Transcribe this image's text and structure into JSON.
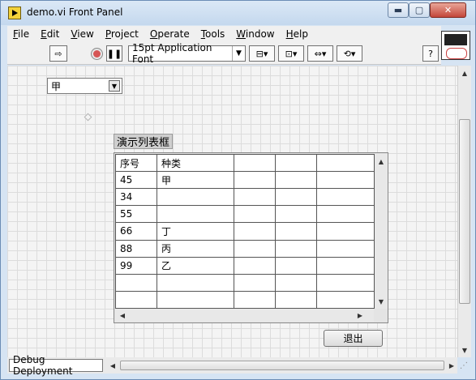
{
  "window": {
    "title": "demo.vi Front Panel",
    "controls": {
      "minimize": "▬",
      "maximize": "▢",
      "close": "✕"
    }
  },
  "menubar": {
    "items": [
      {
        "label": "File",
        "mnemonic": "F",
        "rest": "ile"
      },
      {
        "label": "Edit",
        "mnemonic": "E",
        "rest": "dit"
      },
      {
        "label": "View",
        "mnemonic": "V",
        "rest": "iew"
      },
      {
        "label": "Project",
        "mnemonic": "P",
        "rest": "roject"
      },
      {
        "label": "Operate",
        "mnemonic": "O",
        "rest": "perate"
      },
      {
        "label": "Tools",
        "mnemonic": "T",
        "rest": "ools"
      },
      {
        "label": "Window",
        "mnemonic": "W",
        "rest": "indow"
      },
      {
        "label": "Help",
        "mnemonic": "H",
        "rest": "elp"
      }
    ]
  },
  "toolbar": {
    "run_icon": "⇨",
    "pause_icon": "❚❚",
    "font_value": "15pt Application Font",
    "help_icon": "?"
  },
  "ring_control": {
    "value": "甲"
  },
  "listbox": {
    "label": "演示列表框",
    "headers": [
      "序号",
      "种类",
      "",
      "",
      ""
    ],
    "rows": [
      [
        "45",
        "甲",
        "",
        "",
        ""
      ],
      [
        "34",
        "",
        "",
        "",
        ""
      ],
      [
        "55",
        "",
        "",
        "",
        ""
      ],
      [
        "66",
        "丁",
        "",
        "",
        ""
      ],
      [
        "88",
        "丙",
        "",
        "",
        ""
      ],
      [
        "99",
        "乙",
        "",
        "",
        ""
      ],
      [
        "",
        "",
        "",
        "",
        ""
      ],
      [
        "",
        "",
        "",
        "",
        ""
      ]
    ]
  },
  "exit_button": {
    "label": "退出"
  },
  "bottombar": {
    "target": "Debug Deployment"
  }
}
